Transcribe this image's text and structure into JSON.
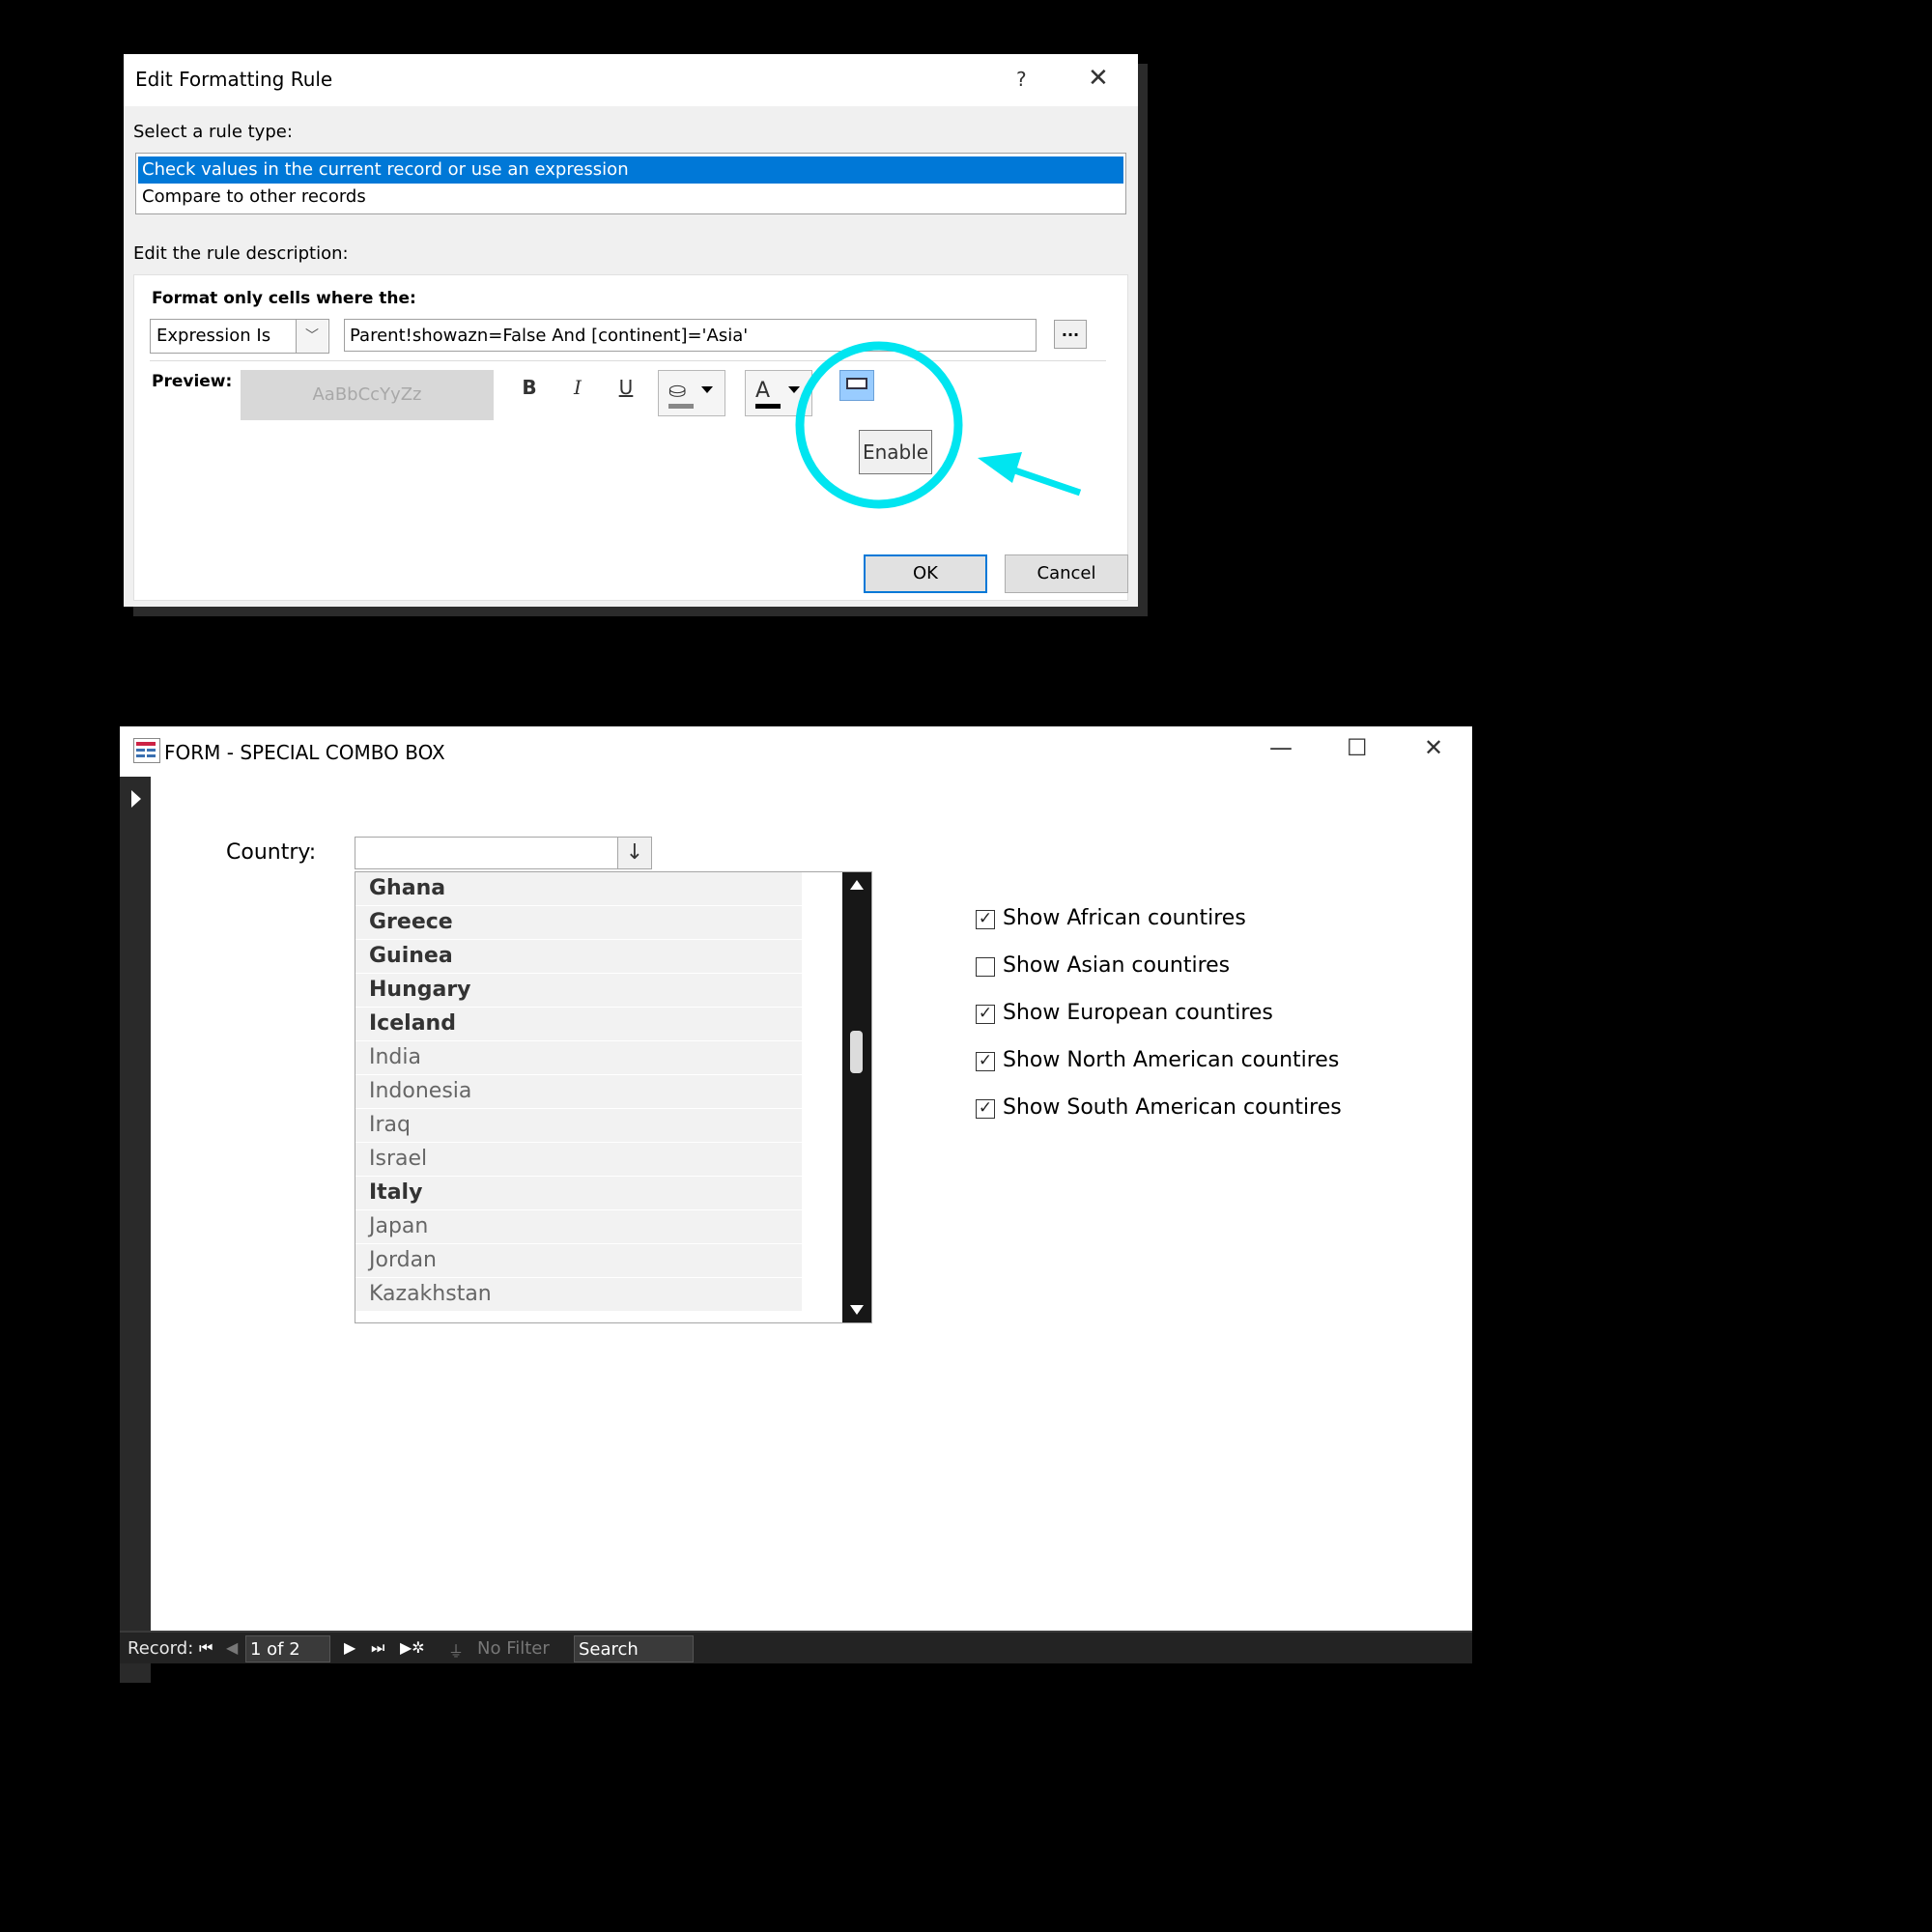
{
  "dialog": {
    "title": "Edit Formatting Rule",
    "help_glyph": "?",
    "close_glyph": "✕",
    "select_rule_label": "Select a rule type:",
    "rule_types": [
      "Check values in the current record or use an expression",
      "Compare to other records"
    ],
    "edit_desc_label": "Edit the rule description:",
    "format_only_label": "Format only cells where the:",
    "condition_type": "Expression Is",
    "expression": "Parent!showazn=False And [continent]='Asia'",
    "ellipsis": "...",
    "preview_label": "Preview:",
    "preview_sample": "AaBbCcYyZz",
    "bold": "B",
    "italic": "I",
    "underline": "U",
    "font_color_glyph": "A",
    "enable_tooltip": "Enable",
    "ok": "OK",
    "cancel": "Cancel"
  },
  "form": {
    "title": "FORM - SPECIAL COMBO BOX",
    "minimize_glyph": "—",
    "maximize_glyph": "☐",
    "close_glyph": "✕",
    "country_label": "Country:",
    "combo_value": "",
    "dropdown_glyph": "↓",
    "list_items": [
      {
        "name": "Ghana",
        "bold": true
      },
      {
        "name": "Greece",
        "bold": true
      },
      {
        "name": "Guinea",
        "bold": true
      },
      {
        "name": "Hungary",
        "bold": true
      },
      {
        "name": "Iceland",
        "bold": true
      },
      {
        "name": "India",
        "bold": false
      },
      {
        "name": "Indonesia",
        "bold": false
      },
      {
        "name": "Iraq",
        "bold": false
      },
      {
        "name": "Israel",
        "bold": false
      },
      {
        "name": "Italy",
        "bold": true
      },
      {
        "name": "Japan",
        "bold": false
      },
      {
        "name": "Jordan",
        "bold": false
      },
      {
        "name": "Kazakhstan",
        "bold": false
      }
    ],
    "checkboxes": [
      {
        "label": "Show African countires",
        "checked": true
      },
      {
        "label": "Show Asian countires",
        "checked": false
      },
      {
        "label": "Show European countires",
        "checked": true
      },
      {
        "label": "Show North American countires",
        "checked": true
      },
      {
        "label": "Show South American countires",
        "checked": true
      }
    ]
  },
  "navbar": {
    "record_label": "Record:",
    "first_glyph": "⏮",
    "prev_glyph": "◀",
    "record_value": "1 of 2",
    "next_glyph": "▶",
    "last_glyph": "⏭",
    "new_glyph": "▶✲",
    "no_filter": "No Filter",
    "search": "Search"
  },
  "colors": {
    "selection": "#0078d7",
    "annotation": "#00e5f0",
    "enable_button": "#99ccff"
  }
}
